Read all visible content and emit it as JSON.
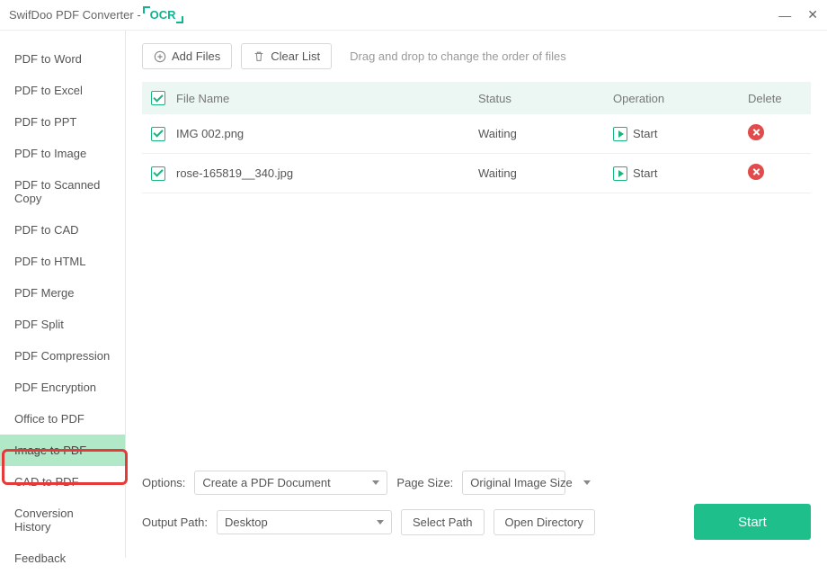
{
  "titlebar": {
    "title": "SwifDoo PDF Converter -",
    "ocr": "OCR"
  },
  "sidebar": {
    "items": [
      {
        "label": "PDF to Word"
      },
      {
        "label": "PDF to Excel"
      },
      {
        "label": "PDF to PPT"
      },
      {
        "label": "PDF to Image"
      },
      {
        "label": "PDF to Scanned Copy"
      },
      {
        "label": "PDF to CAD"
      },
      {
        "label": "PDF to HTML"
      },
      {
        "label": "PDF Merge"
      },
      {
        "label": "PDF Split"
      },
      {
        "label": "PDF Compression"
      },
      {
        "label": "PDF Encryption"
      },
      {
        "label": "Office to PDF"
      },
      {
        "label": "Image to PDF"
      },
      {
        "label": "CAD to PDF"
      },
      {
        "label": "Conversion History"
      },
      {
        "label": "Feedback"
      }
    ],
    "active_index": 12
  },
  "toolbar": {
    "add_label": "Add Files",
    "clear_label": "Clear List",
    "hint": "Drag and drop to change the order of files"
  },
  "table": {
    "headers": {
      "name": "File Name",
      "status": "Status",
      "operation": "Operation",
      "delete": "Delete"
    },
    "rows": [
      {
        "name": "IMG 002.png",
        "status": "Waiting",
        "op": "Start"
      },
      {
        "name": "rose-165819__340.jpg",
        "status": "Waiting",
        "op": "Start"
      }
    ]
  },
  "footer": {
    "options_label": "Options:",
    "options_value": "Create a PDF Document",
    "pagesize_label": "Page Size:",
    "pagesize_value": "Original Image Size",
    "output_label": "Output Path:",
    "output_value": "Desktop",
    "select_path_label": "Select Path",
    "open_dir_label": "Open Directory",
    "start_label": "Start"
  }
}
